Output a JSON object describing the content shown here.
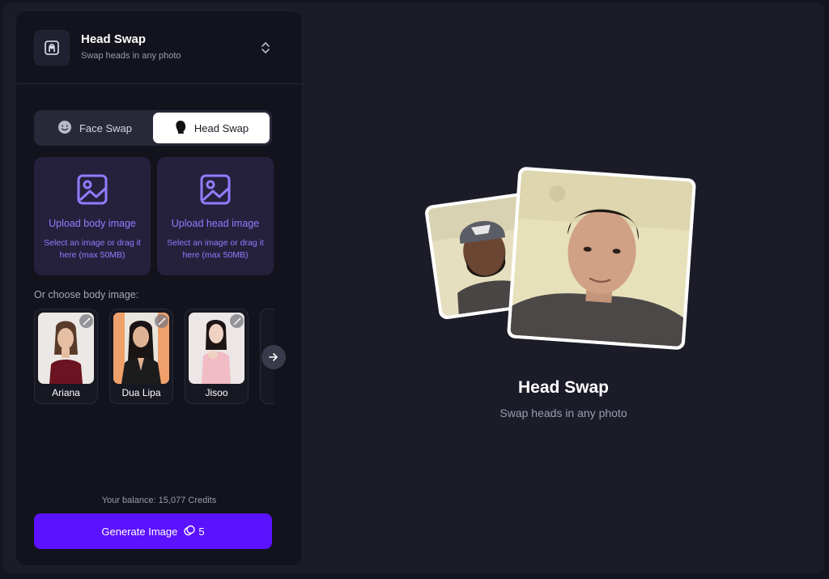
{
  "tool": {
    "title": "Head Swap",
    "subtitle": "Swap heads in any photo",
    "icon": "head-frame-icon"
  },
  "tabs": [
    {
      "label": "Face Swap",
      "icon": "smile-icon",
      "active": false
    },
    {
      "label": "Head Swap",
      "icon": "head-silhouette-icon",
      "active": true
    }
  ],
  "upload": {
    "body": {
      "title": "Upload body image",
      "desc": "Select an image or drag it here (max 50MB)",
      "icon": "image-icon"
    },
    "head": {
      "title": "Upload head image",
      "desc": "Select an image or drag it here (max 50MB)",
      "icon": "image-icon"
    }
  },
  "presets": {
    "label": "Or choose body image:",
    "items": [
      {
        "name": "Ariana"
      },
      {
        "name": "Dua Lipa"
      },
      {
        "name": "Jisoo"
      }
    ]
  },
  "footer": {
    "balance": "Your balance: 15,077 Credits",
    "generate_label": "Generate Image",
    "cost": "5"
  },
  "hero": {
    "title": "Head Swap",
    "subtitle": "Swap heads in any photo"
  },
  "colors": {
    "accent": "#5b12ff",
    "upload_text": "#8f7dff",
    "upload_bg": "#25213d"
  }
}
